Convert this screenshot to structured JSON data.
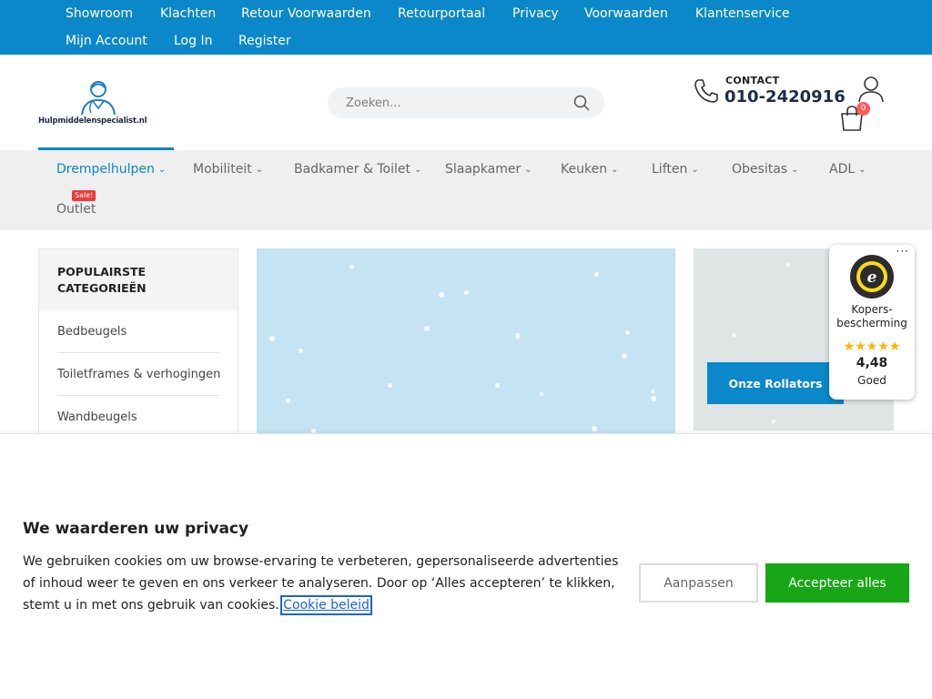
{
  "topbar": {
    "links": [
      "Showroom",
      "Klachten",
      "Retour Voorwaarden",
      "Retourportaal",
      "Privacy",
      "Voorwaarden",
      "Klantenservice",
      "Mijn Account",
      "Log In",
      "Register"
    ]
  },
  "header": {
    "logo_text": "Hulpmiddelenspecialist.nl",
    "search_placeholder": "Zoeken...",
    "contact_label": "CONTACT",
    "contact_phone": "010-2420916",
    "cart_count": "0"
  },
  "nav": {
    "items": [
      "Drempelhulpen",
      "Mobiliteit",
      "Badkamer & Toilet",
      "Slaapkamer",
      "Keuken",
      "Liften",
      "Obesitas",
      "ADL"
    ],
    "active": "Drempelhulpen",
    "outlet": "Outlet",
    "sale_badge": "Sale!"
  },
  "sidebar": {
    "title": "POPULAIRSTE CATEGORIEËN",
    "categories": [
      "Bedbeugels",
      "Toiletframes & verhogingen",
      "Wandbeugels"
    ]
  },
  "promo": {
    "button_label": "Onze Rollators"
  },
  "trusted": {
    "label": "Kopers-bescherming",
    "score": "4,48",
    "grade": "Goed",
    "stars": "★★★★★",
    "more": "···"
  },
  "cookie": {
    "title": "We waarderen uw privacy",
    "text": "We gebruiken cookies om uw browse-ervaring te verbeteren, gepersonaliseerde advertenties of inhoud weer te geven en ons verkeer te analyseren. Door op ‘Alles accepteren’ te klikken, stemt u in met ons gebruik van cookies.",
    "link": "Cookie beleid",
    "customize": "Aanpassen",
    "accept": "Accepteer alles"
  },
  "colors": {
    "brand_blue": "#0a88c9",
    "accept_green": "#19a616",
    "badge_red": "#ea3b3b"
  }
}
